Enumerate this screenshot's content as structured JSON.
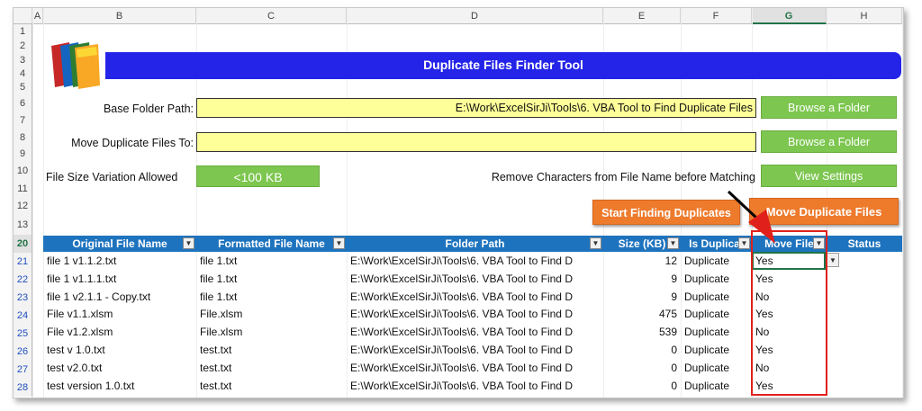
{
  "columns": [
    "A",
    "B",
    "C",
    "D",
    "E",
    "F",
    "G",
    "H"
  ],
  "selected_column": "G",
  "row_numbers": [
    "1",
    "2",
    "3",
    "4",
    "5",
    "6",
    "7",
    "8",
    "9",
    "10",
    "11",
    "12",
    "13",
    "20",
    "21",
    "22",
    "23",
    "24",
    "25",
    "26",
    "27",
    "28"
  ],
  "tool": {
    "title": "Duplicate Files Finder Tool",
    "base_folder_label": "Base Folder Path:",
    "base_folder_value": "E:\\Work\\ExcelSirJi\\Tools\\6. VBA Tool to Find Duplicate Files",
    "move_to_label": "Move Duplicate Files To:",
    "move_to_value": "",
    "size_variation_label": "File Size Variation Allowed",
    "size_variation_value": "<100 KB",
    "remove_chars_label": "Remove Characters from File Name before Matching",
    "browse_btn_1": "Browse a Folder",
    "browse_btn_2": "Browse a Folder",
    "view_settings_btn": "View Settings",
    "start_btn": "Start Finding Duplicates",
    "move_btn": "Move Duplicate Files"
  },
  "table": {
    "headers": [
      "Original File Name",
      "Formatted File Name",
      "Folder Path",
      "Size (KB)",
      "Is Duplicat",
      "Move File",
      "Status"
    ],
    "rows": [
      [
        "file 1 v1.1.2.txt",
        "file 1.txt",
        "E:\\Work\\ExcelSirJi\\Tools\\6. VBA Tool to Find D",
        "12",
        "Duplicate",
        "Yes",
        ""
      ],
      [
        "file 1 v1.1.1.txt",
        "file 1.txt",
        "E:\\Work\\ExcelSirJi\\Tools\\6. VBA Tool to Find D",
        "9",
        "Duplicate",
        "Yes",
        ""
      ],
      [
        "file 1 v2.1.1 - Copy.txt",
        "file 1.txt",
        "E:\\Work\\ExcelSirJi\\Tools\\6. VBA Tool to Find D",
        "9",
        "Duplicate",
        "No",
        ""
      ],
      [
        "File v1.1.xlsm",
        "File.xlsm",
        "E:\\Work\\ExcelSirJi\\Tools\\6. VBA Tool to Find D",
        "475",
        "Duplicate",
        "Yes",
        ""
      ],
      [
        "File v1.2.xlsm",
        "File.xlsm",
        "E:\\Work\\ExcelSirJi\\Tools\\6. VBA Tool to Find D",
        "539",
        "Duplicate",
        "No",
        ""
      ],
      [
        "test v 1.0.txt",
        "test.txt",
        "E:\\Work\\ExcelSirJi\\Tools\\6. VBA Tool to Find D",
        "0",
        "Duplicate",
        "Yes",
        ""
      ],
      [
        "test v2.0.txt",
        "test.txt",
        "E:\\Work\\ExcelSirJi\\Tools\\6. VBA Tool to Find D",
        "0",
        "Duplicate",
        "No",
        ""
      ],
      [
        "test version 1.0.txt",
        "test.txt",
        "E:\\Work\\ExcelSirJi\\Tools\\6. VBA Tool to Find D",
        "0",
        "Duplicate",
        "Yes",
        ""
      ]
    ]
  },
  "colors": {
    "title_bar": "#2424e8",
    "input_fill": "#ffff99",
    "green_button": "#7dc650",
    "orange_button": "#ee7a2c",
    "table_header": "#1e73be",
    "highlight_box": "#e0201b"
  },
  "icons": {
    "logo": "folders-icon",
    "arrow": "red-arrow-icon",
    "dropdown": "chevron-down-icon"
  }
}
